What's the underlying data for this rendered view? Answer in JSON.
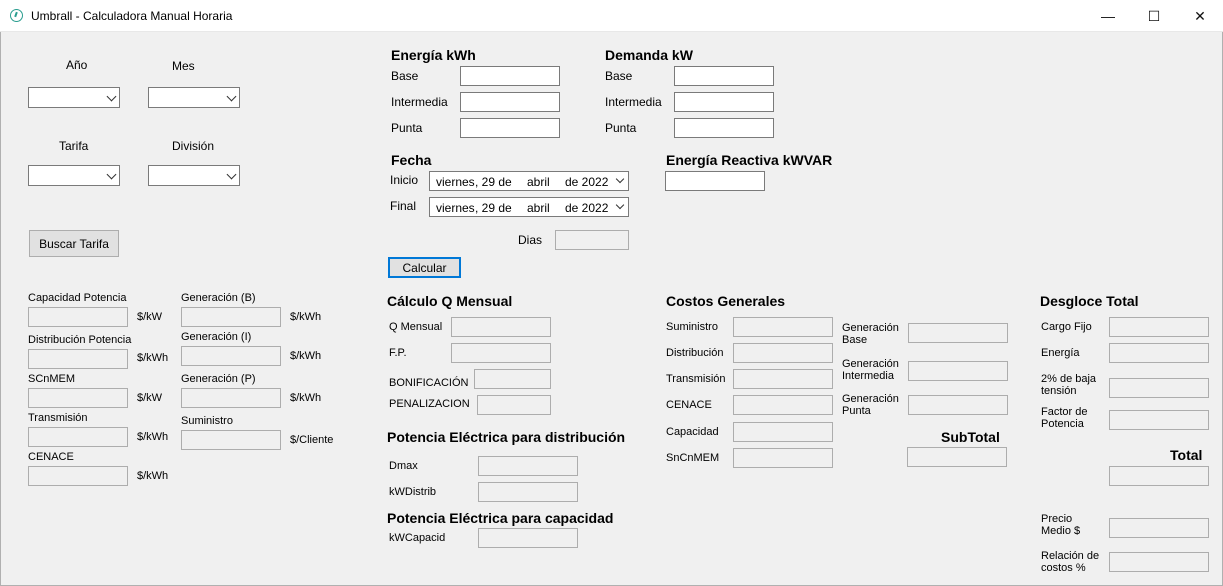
{
  "window": {
    "title": "Umbrall - Calculadora Manual Horaria",
    "minimize_glyph": "—",
    "maximize_glyph": "☐",
    "close_glyph": "✕",
    "icon": "app-logo-icon"
  },
  "filters": {
    "anio_label": "Año",
    "mes_label": "Mes",
    "tarifa_label": "Tarifa",
    "division_label": "División",
    "anio_value": "",
    "mes_value": "",
    "tarifa_value": "",
    "division_value": "",
    "buscar_button": "Buscar Tarifa"
  },
  "tarifas": {
    "capacidad_potencia": {
      "label": "Capacidad Potencia",
      "unit": "$/kW",
      "value": ""
    },
    "distribucion_potencia": {
      "label": "Distribución Potencia",
      "unit": "$/kWh",
      "value": ""
    },
    "scnmem": {
      "label": "SCnMEM",
      "unit": "$/kW",
      "value": ""
    },
    "transmision": {
      "label": "Transmisión",
      "unit": "$/kWh",
      "value": ""
    },
    "cenace": {
      "label": "CENACE",
      "unit": "$/kWh",
      "value": ""
    },
    "generacion_b": {
      "label": "Generación (B)",
      "unit": "$/kWh",
      "value": ""
    },
    "generacion_i": {
      "label": "Generación (I)",
      "unit": "$/kWh",
      "value": ""
    },
    "generacion_p": {
      "label": "Generación (P)",
      "unit": "$/kWh",
      "value": ""
    },
    "suministro": {
      "label": "Suministro",
      "unit": "$/Cliente",
      "value": ""
    }
  },
  "energia": {
    "title": "Energía kWh",
    "base_label": "Base",
    "intermedia_label": "Intermedia",
    "punta_label": "Punta",
    "base_value": "",
    "intermedia_value": "",
    "punta_value": ""
  },
  "demanda": {
    "title": "Demanda kW",
    "base_label": "Base",
    "intermedia_label": "Intermedia",
    "punta_label": "Punta",
    "base_value": "",
    "intermedia_value": "",
    "punta_value": ""
  },
  "fecha": {
    "title": "Fecha",
    "inicio_label": "Inicio",
    "final_label": "Final",
    "inicio": {
      "weekday": "viernes",
      "day": ", 29 de",
      "month": "abril",
      "year": "de 2022"
    },
    "final": {
      "weekday": "viernes",
      "day": ", 29 de",
      "month": "abril",
      "year": "de 2022"
    },
    "dias_label": "Dias",
    "dias_value": "",
    "calcular_button": "Calcular"
  },
  "reactiva": {
    "title": "Energía Reactiva kWVAR",
    "value": ""
  },
  "calculo_q": {
    "title": "Cálculo Q Mensual",
    "q_mensual_label": "Q Mensual",
    "fp_label": "F.P.",
    "bonificacion_label": "BONIFICACIÓN",
    "penalizacion_label": "PENALIZACION"
  },
  "potencia_distribucion": {
    "title": "Potencia Eléctrica para distribución",
    "dmax_label": "Dmax",
    "kwdistrib_label": "kWDistrib"
  },
  "potencia_capacidad": {
    "title": "Potencia Eléctrica para capacidad",
    "kwcapacid_label": "kWCapacid"
  },
  "costos": {
    "title": "Costos Generales",
    "suministro_label": "Suministro",
    "distribucion_label": "Distribución",
    "transmision_label": "Transmisión",
    "cenace_label": "CENACE",
    "capacidad_label": "Capacidad",
    "sncnmem_label": "SnCnMEM",
    "gen_base_label_1": "Generación",
    "gen_base_label_2": "Base",
    "gen_intermedia_label_1": "Generación",
    "gen_intermedia_label_2": "Intermedia",
    "gen_punta_label_1": "Generación",
    "gen_punta_label_2": "Punta",
    "subtotal_label": "SubTotal"
  },
  "desgloce": {
    "title": "Desgloce Total",
    "cargo_fijo_label": "Cargo Fijo",
    "energia_label": "Energía",
    "baja_tension_label_1": "2% de baja",
    "baja_tension_label_2": "tensión",
    "factor_potencia_label_1": "Factor de",
    "factor_potencia_label_2": "Potencia",
    "total_label": "Total",
    "precio_medio_label_1": "Precio",
    "precio_medio_label_2": "Medio $",
    "relacion_costos_label_1": "Relación de",
    "relacion_costos_label_2": "costos %"
  }
}
